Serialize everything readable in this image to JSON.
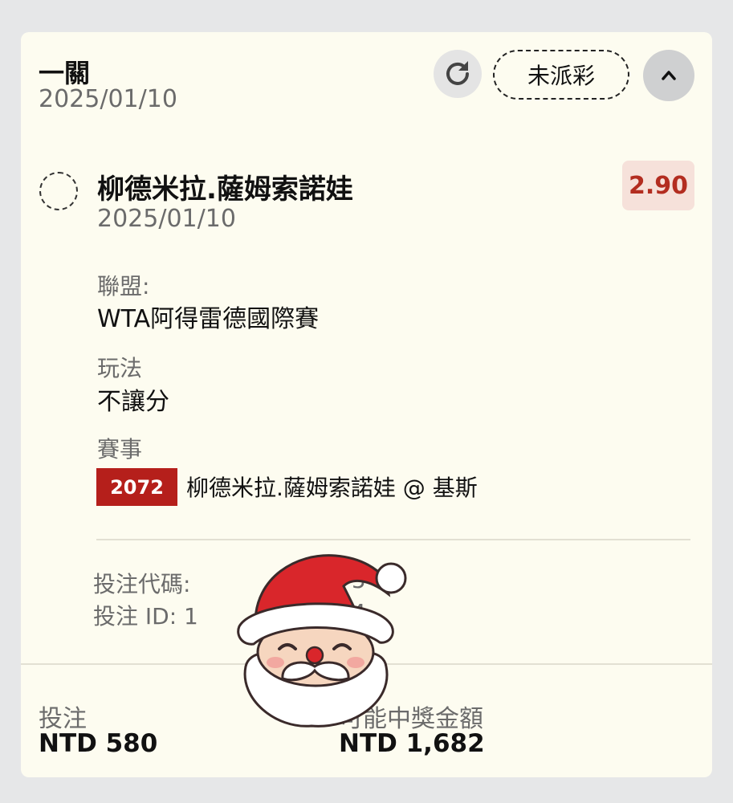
{
  "header": {
    "title": "一關",
    "date": "2025/01/10",
    "status": "未派彩"
  },
  "selection": {
    "name": "柳德米拉.薩姆索諾娃",
    "date": "2025/01/10",
    "odds": "2.90"
  },
  "details": {
    "league_label": "聯盟:",
    "league_value": "WTA阿得雷德國際賽",
    "market_label": "玩法",
    "market_value": "不讓分",
    "event_label": "賽事",
    "event_code": "2072",
    "event_name": "柳德米拉.薩姆索諾娃 @ 基斯"
  },
  "bet_meta": {
    "code_text": "投注代碼:",
    "id_text": "投注 ID: 1",
    "code_tail": "5",
    "id_tail": "4"
  },
  "footer": {
    "stake_label": "投注",
    "stake_value": "NTD 580",
    "payout_label": "可能中獎金額",
    "payout_value": "NTD 1,682"
  },
  "colors": {
    "odds_text": "#b32d20",
    "event_code_bg": "#b51f1b",
    "card_bg": "#fdfcf0"
  },
  "icons": {
    "refresh": "refresh-icon",
    "collapse": "chevron-up-icon",
    "sticker": "santa-sticker"
  }
}
